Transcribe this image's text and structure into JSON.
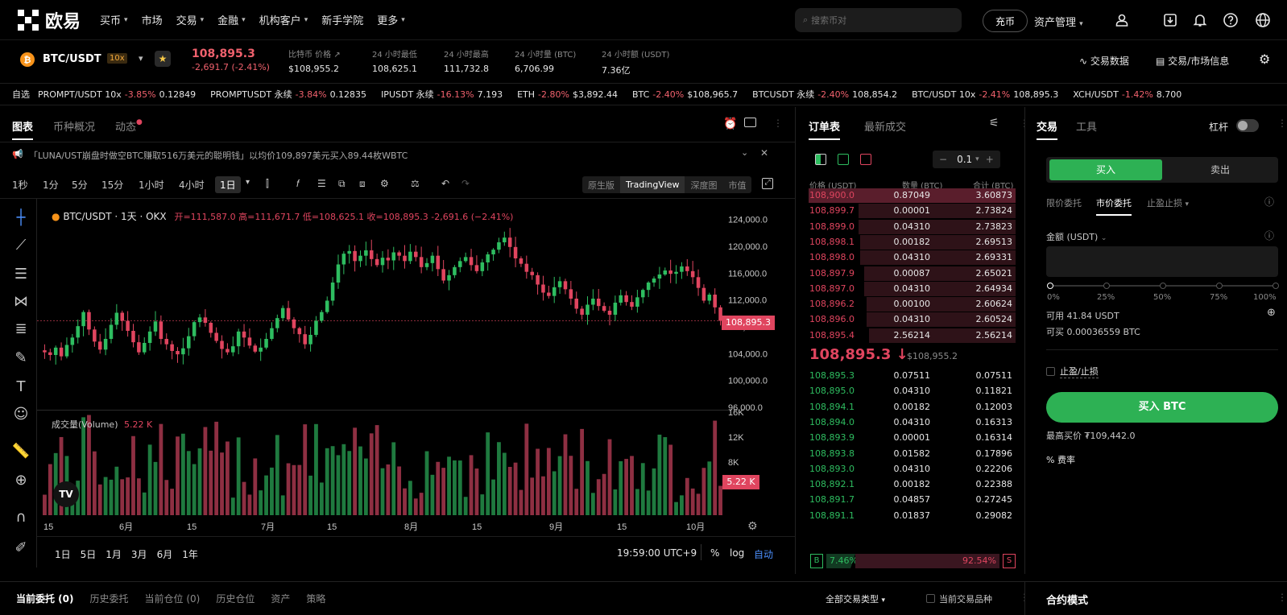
{
  "nav": {
    "logo_text": "欧易",
    "items": [
      "买币",
      "市场",
      "交易",
      "金融",
      "机构客户",
      "新手学院",
      "更多"
    ],
    "search_placeholder": "搜索币对",
    "deposit": "充币",
    "asset_mgmt": "资产管理"
  },
  "ticker": {
    "coin_symbol": "₿",
    "pair": "BTC/USDT",
    "leverage": "10x",
    "last_price": "108,895.3",
    "change": "-2,691.7 (-2.41%)",
    "stats": [
      {
        "label": "比特币 价格 ↗",
        "value": "$108,955.2"
      },
      {
        "label": "24 小时最低",
        "value": "108,625.1"
      },
      {
        "label": "24 小时最高",
        "value": "111,732.8"
      },
      {
        "label": "24 小时量 (BTC)",
        "value": "6,706.99"
      },
      {
        "label": "24 小时额 (USDT)",
        "value": "7.36亿"
      }
    ],
    "right_links": [
      "交易数据",
      "交易/市场信息"
    ]
  },
  "favorites": {
    "label": "自选",
    "items": [
      {
        "name": "PROMPT/USDT 10x",
        "change": "-3.85%",
        "price": "0.12849"
      },
      {
        "name": "PROMPTUSDT 永续",
        "change": "-3.84%",
        "price": "0.12835"
      },
      {
        "name": "IPUSDT 永续",
        "change": "-16.13%",
        "price": "7.193"
      },
      {
        "name": "ETH",
        "change": "-2.80%",
        "price": "$3,892.44"
      },
      {
        "name": "BTC",
        "change": "-2.40%",
        "price": "$108,965.7"
      },
      {
        "name": "BTCUSDT 永续",
        "change": "-2.40%",
        "price": "108,854.2"
      },
      {
        "name": "BTC/USDT 10x",
        "change": "-2.41%",
        "price": "108,895.3"
      },
      {
        "name": "XCH/USDT",
        "change": "-1.42%",
        "price": "8.700"
      }
    ]
  },
  "chart_panel": {
    "tabs": [
      "图表",
      "币种概况",
      "动态"
    ],
    "news": "「LUNA/UST崩盘时做空BTC赚取516万美元的聪明钱」以均价109,897美元买入89.44枚WBTC",
    "timeframes": [
      "1秒",
      "1分",
      "5分",
      "15分",
      "1小时",
      "4小时",
      "1日"
    ],
    "versions": [
      "原生版",
      "TradingView",
      "深度图",
      "市值"
    ],
    "legend_title": "BTC/USDT · 1天 · OKX",
    "ohlc": "开=111,587.0 高=111,671.7 低=108,625.1 收=108,895.3 -2,691.6 (−2.41%)",
    "price_ticks": [
      "124,000.0",
      "120,000.0",
      "116,000.0",
      "112,000.0",
      "108,000.0",
      "104,000.0",
      "100,000.0",
      "96,000.0"
    ],
    "price_tag": "108,895.3",
    "volume_label": "成交量(Volume)",
    "volume_value": "5.22 K",
    "vol_ticks": [
      "16K",
      "12K",
      "8K",
      "4K"
    ],
    "vol_tag": "5.22 K",
    "date_ticks": [
      "15",
      "6月",
      "15",
      "7月",
      "15",
      "8月",
      "15",
      "9月",
      "15",
      "10月"
    ],
    "ranges": [
      "1日",
      "5日",
      "1月",
      "3月",
      "6月",
      "1年"
    ],
    "clock": "19:59:00 UTC+9",
    "pct": "%",
    "log": "log",
    "auto": "自动"
  },
  "chart_data": {
    "type": "candlestick",
    "title": "BTC/USDT · 1天 · OKX",
    "ylim": [
      96000,
      126000
    ],
    "last": 108895.3,
    "closes": [
      104200,
      103800,
      104900,
      103600,
      105300,
      106400,
      108100,
      110200,
      107600,
      105800,
      104600,
      106200,
      108300,
      110100,
      108900,
      107400,
      105700,
      104200,
      105600,
      107300,
      108800,
      106200,
      105400,
      104400,
      103900,
      104800,
      106600,
      108700,
      109400,
      108600,
      107100,
      105900,
      104700,
      104200,
      105100,
      107300,
      106400,
      105200,
      104300,
      104900,
      106200,
      107800,
      109300,
      110800,
      109100,
      107800,
      106900,
      105400,
      106800,
      108900,
      110200,
      111900,
      114600,
      117300,
      118900,
      119300,
      117800,
      118600,
      119400,
      118100,
      117200,
      118300,
      117900,
      119100,
      118600,
      117800,
      119200,
      118400,
      116900,
      117500,
      118600,
      116600,
      114900,
      115700,
      116900,
      117800,
      118400,
      117200,
      116300,
      117600,
      118800,
      119500,
      120600,
      121300,
      119900,
      118200,
      117400,
      116200,
      115700,
      114300,
      113100,
      112600,
      113900,
      114800,
      113600,
      112200,
      110700,
      109800,
      111300,
      112200,
      111100,
      110400,
      109800,
      111600,
      112700,
      111700,
      111000,
      112400,
      113500,
      114600,
      115200,
      115800,
      116400,
      115900,
      116200,
      117000,
      116300,
      115400,
      113800,
      111900,
      112800,
      110900,
      108895
    ]
  },
  "orderbook": {
    "tabs": [
      "订单表",
      "最新成交"
    ],
    "step": "0.1",
    "headers": [
      "价格 (USDT)",
      "数量 (BTC)",
      "合计 (BTC)"
    ],
    "asks": [
      [
        "108,900.0",
        "0.87049",
        "3.60873"
      ],
      [
        "108,899.7",
        "0.00001",
        "2.73824"
      ],
      [
        "108,899.0",
        "0.04310",
        "2.73823"
      ],
      [
        "108,898.1",
        "0.00182",
        "2.69513"
      ],
      [
        "108,898.0",
        "0.04310",
        "2.69331"
      ],
      [
        "108,897.9",
        "0.00087",
        "2.65021"
      ],
      [
        "108,897.0",
        "0.04310",
        "2.64934"
      ],
      [
        "108,896.2",
        "0.00100",
        "2.60624"
      ],
      [
        "108,896.0",
        "0.04310",
        "2.60524"
      ],
      [
        "108,895.4",
        "2.56214",
        "2.56214"
      ]
    ],
    "ask_depth": [
      1.0,
      0.76,
      0.76,
      0.75,
      0.75,
      0.73,
      0.73,
      0.72,
      0.72,
      0.71
    ],
    "mid_price": "108,895.3 ↓",
    "mid_index": "$108,955.2",
    "bids": [
      [
        "108,895.3",
        "0.07511",
        "0.07511"
      ],
      [
        "108,895.0",
        "0.04310",
        "0.11821"
      ],
      [
        "108,894.1",
        "0.00182",
        "0.12003"
      ],
      [
        "108,894.0",
        "0.04310",
        "0.16313"
      ],
      [
        "108,893.9",
        "0.00001",
        "0.16314"
      ],
      [
        "108,893.8",
        "0.01582",
        "0.17896"
      ],
      [
        "108,893.0",
        "0.04310",
        "0.22206"
      ],
      [
        "108,892.1",
        "0.00182",
        "0.22388"
      ],
      [
        "108,891.7",
        "0.04857",
        "0.27245"
      ],
      [
        "108,891.1",
        "0.01837",
        "0.29082"
      ]
    ],
    "buy_pct": "7.46%",
    "sell_pct": "92.54%",
    "buy_ratio": 0.0746
  },
  "trade": {
    "tabs": [
      "交易",
      "工具"
    ],
    "leverage_label": "杠杆",
    "buy": "买入",
    "sell": "卖出",
    "order_types": [
      "限价委托",
      "市价委托",
      "止盈止损"
    ],
    "amount_label": "金额 (USDT)",
    "slider_marks": [
      "0%",
      "25%",
      "50%",
      "75%",
      "100%"
    ],
    "available": "可用 41.84 USDT",
    "can_buy": "可买 0.00036559 BTC",
    "tpsl": "止盈/止损",
    "submit": "买入 BTC",
    "max_price": "最高买价 ₮109,442.0",
    "fee": "% 费率"
  },
  "bottom": {
    "tabs": [
      "当前委托 (0)",
      "历史委托",
      "当前仓位 (0)",
      "历史仓位",
      "资产",
      "策略"
    ],
    "filter": "全部交易类型",
    "current_only": "当前交易品种",
    "contract_mode": "合约模式"
  },
  "colors": {
    "up": "#2ebd60",
    "down": "#e0455f",
    "accent": "#2db154"
  }
}
